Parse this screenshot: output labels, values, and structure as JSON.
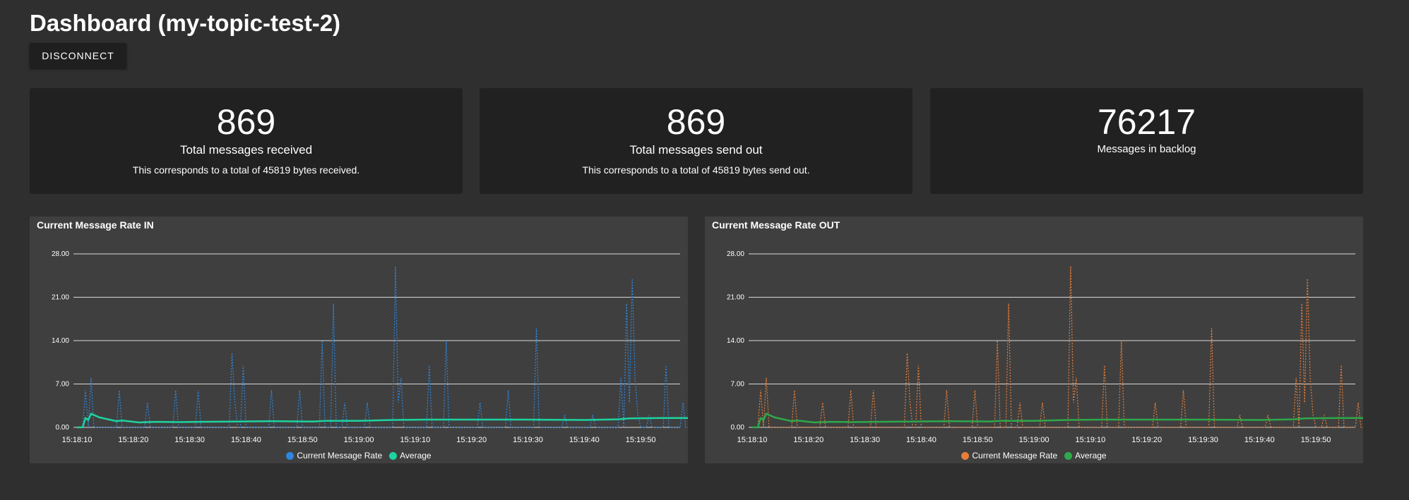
{
  "page": {
    "title": "Dashboard (my-topic-test-2)"
  },
  "toolbar": {
    "disconnect_label": "DISCONNECT"
  },
  "cards": {
    "received": {
      "value": "869",
      "label": "Total messages received",
      "desc": "This corresponds to a total of 45819 bytes received."
    },
    "sent": {
      "value": "869",
      "label": "Total messages send out",
      "desc": "This corresponds to a total of 45819 bytes send out."
    },
    "backlog": {
      "value": "76217",
      "label": "Messages in backlog"
    }
  },
  "charts": {
    "in": {
      "title": "Current Message Rate IN",
      "legend_rate": "Current Message Rate",
      "legend_avg": "Average",
      "rate_color": "#2e86de",
      "avg_color": "#1dd3a0"
    },
    "out": {
      "title": "Current Message Rate OUT",
      "legend_rate": "Current Message Rate",
      "legend_avg": "Average",
      "rate_color": "#e67e3a",
      "avg_color": "#2ea84a"
    }
  },
  "chart_data": [
    {
      "type": "line",
      "title": "Current Message Rate IN",
      "xlabel": "",
      "ylabel": "",
      "x_start": "15:18:10",
      "x_end": "15:19:57",
      "x_ticks": [
        "15:18:10",
        "15:18:20",
        "15:18:30",
        "15:18:40",
        "15:18:50",
        "15:19:00",
        "15:19:10",
        "15:19:20",
        "15:19:30",
        "15:19:40",
        "15:19:50"
      ],
      "y_ticks": [
        "0.00",
        "7.00",
        "14.00",
        "21.00",
        "28.00"
      ],
      "ylim": [
        0,
        28
      ],
      "grid": true,
      "legend": "bottom-center",
      "series": [
        {
          "name": "Current Message Rate",
          "style": "dotted",
          "points": [
            [
              0,
              0
            ],
            [
              1,
              0
            ],
            [
              1.5,
              6
            ],
            [
              2,
              0
            ],
            [
              2.5,
              8
            ],
            [
              3,
              0
            ],
            [
              7,
              0
            ],
            [
              7.5,
              6
            ],
            [
              8,
              0
            ],
            [
              12,
              0
            ],
            [
              12.5,
              4
            ],
            [
              13,
              0
            ],
            [
              17,
              0
            ],
            [
              17.5,
              6
            ],
            [
              18,
              0
            ],
            [
              21,
              0
            ],
            [
              21.5,
              6
            ],
            [
              22,
              0
            ],
            [
              27,
              0
            ],
            [
              27.5,
              12
            ],
            [
              28,
              4
            ],
            [
              28.5,
              0
            ],
            [
              29,
              0
            ],
            [
              29.5,
              10
            ],
            [
              30,
              0
            ],
            [
              34,
              0
            ],
            [
              34.5,
              6
            ],
            [
              35,
              0
            ],
            [
              39,
              0
            ],
            [
              39.5,
              6
            ],
            [
              40,
              0
            ],
            [
              43,
              0
            ],
            [
              43.5,
              14
            ],
            [
              44,
              0
            ],
            [
              45,
              0
            ],
            [
              45.5,
              20
            ],
            [
              46,
              0
            ],
            [
              47,
              0
            ],
            [
              47.5,
              4
            ],
            [
              48,
              0
            ],
            [
              51,
              0
            ],
            [
              51.5,
              4
            ],
            [
              52,
              0
            ],
            [
              56,
              0
            ],
            [
              56.5,
              26
            ],
            [
              57,
              4
            ],
            [
              57.5,
              8
            ],
            [
              58,
              0
            ],
            [
              62,
              0
            ],
            [
              62.5,
              10
            ],
            [
              63,
              0
            ],
            [
              65,
              0
            ],
            [
              65.5,
              14
            ],
            [
              66,
              0
            ],
            [
              71,
              0
            ],
            [
              71.5,
              4
            ],
            [
              72,
              0
            ],
            [
              76,
              0
            ],
            [
              76.5,
              6
            ],
            [
              77,
              0
            ],
            [
              81,
              0
            ],
            [
              81.5,
              16
            ],
            [
              82,
              0
            ],
            [
              86,
              0
            ],
            [
              86.5,
              2
            ],
            [
              87,
              0
            ],
            [
              91,
              0
            ],
            [
              91.5,
              2
            ],
            [
              92,
              0
            ],
            [
              96,
              0
            ],
            [
              96.5,
              8
            ],
            [
              97,
              0
            ],
            [
              97.5,
              20
            ],
            [
              98,
              4
            ],
            [
              98.5,
              24
            ],
            [
              99,
              8
            ],
            [
              99.5,
              2
            ],
            [
              100,
              0
            ],
            [
              101,
              0
            ],
            [
              101.5,
              2
            ],
            [
              102,
              0
            ],
            [
              104,
              0
            ],
            [
              104.5,
              10
            ],
            [
              105,
              0
            ],
            [
              107,
              0
            ],
            [
              107.5,
              4
            ],
            [
              108,
              0
            ],
            [
              110,
              0
            ]
          ]
        },
        {
          "name": "Average",
          "style": "solid",
          "points": [
            [
              0,
              0
            ],
            [
              1,
              0
            ],
            [
              1.5,
              1.5
            ],
            [
              2,
              1.2
            ],
            [
              2.5,
              2.2
            ],
            [
              4,
              1.6
            ],
            [
              7,
              1.0
            ],
            [
              8,
              1.1
            ],
            [
              11,
              0.8
            ],
            [
              14,
              0.9
            ],
            [
              18,
              0.85
            ],
            [
              22,
              0.9
            ],
            [
              28,
              0.95
            ],
            [
              35,
              1.0
            ],
            [
              42,
              0.95
            ],
            [
              44,
              1.05
            ],
            [
              50,
              1.05
            ],
            [
              56,
              1.2
            ],
            [
              62,
              1.25
            ],
            [
              70,
              1.25
            ],
            [
              80,
              1.25
            ],
            [
              90,
              1.2
            ],
            [
              96,
              1.3
            ],
            [
              98,
              1.45
            ],
            [
              104,
              1.5
            ],
            [
              110,
              1.5
            ]
          ]
        }
      ]
    },
    {
      "type": "line",
      "title": "Current Message Rate OUT",
      "xlabel": "",
      "ylabel": "",
      "x_start": "15:18:10",
      "x_end": "15:19:57",
      "x_ticks": [
        "15:18:10",
        "15:18:20",
        "15:18:30",
        "15:18:40",
        "15:18:50",
        "15:19:00",
        "15:19:10",
        "15:19:20",
        "15:19:30",
        "15:19:40",
        "15:19:50"
      ],
      "y_ticks": [
        "0.00",
        "7.00",
        "14.00",
        "21.00",
        "28.00"
      ],
      "ylim": [
        0,
        28
      ],
      "grid": true,
      "legend": "bottom-center",
      "series": [
        {
          "name": "Current Message Rate",
          "style": "dotted",
          "points": [
            [
              0,
              0
            ],
            [
              1,
              0
            ],
            [
              1.5,
              6
            ],
            [
              2,
              0
            ],
            [
              2.5,
              8
            ],
            [
              3,
              0
            ],
            [
              7,
              0
            ],
            [
              7.5,
              6
            ],
            [
              8,
              0
            ],
            [
              12,
              0
            ],
            [
              12.5,
              4
            ],
            [
              13,
              0
            ],
            [
              17,
              0
            ],
            [
              17.5,
              6
            ],
            [
              18,
              0
            ],
            [
              21,
              0
            ],
            [
              21.5,
              6
            ],
            [
              22,
              0
            ],
            [
              27,
              0
            ],
            [
              27.5,
              12
            ],
            [
              28,
              4
            ],
            [
              28.5,
              0
            ],
            [
              29,
              0
            ],
            [
              29.5,
              10
            ],
            [
              30,
              0
            ],
            [
              34,
              0
            ],
            [
              34.5,
              6
            ],
            [
              35,
              0
            ],
            [
              39,
              0
            ],
            [
              39.5,
              6
            ],
            [
              40,
              0
            ],
            [
              43,
              0
            ],
            [
              43.5,
              14
            ],
            [
              44,
              0
            ],
            [
              45,
              0
            ],
            [
              45.5,
              20
            ],
            [
              46,
              0
            ],
            [
              47,
              0
            ],
            [
              47.5,
              4
            ],
            [
              48,
              0
            ],
            [
              51,
              0
            ],
            [
              51.5,
              4
            ],
            [
              52,
              0
            ],
            [
              56,
              0
            ],
            [
              56.5,
              26
            ],
            [
              57,
              4
            ],
            [
              57.5,
              8
            ],
            [
              58,
              0
            ],
            [
              62,
              0
            ],
            [
              62.5,
              10
            ],
            [
              63,
              0
            ],
            [
              65,
              0
            ],
            [
              65.5,
              14
            ],
            [
              66,
              0
            ],
            [
              71,
              0
            ],
            [
              71.5,
              4
            ],
            [
              72,
              0
            ],
            [
              76,
              0
            ],
            [
              76.5,
              6
            ],
            [
              77,
              0
            ],
            [
              81,
              0
            ],
            [
              81.5,
              16
            ],
            [
              82,
              0
            ],
            [
              86,
              0
            ],
            [
              86.5,
              2
            ],
            [
              87,
              0
            ],
            [
              91,
              0
            ],
            [
              91.5,
              2
            ],
            [
              92,
              0
            ],
            [
              96,
              0
            ],
            [
              96.5,
              8
            ],
            [
              97,
              0
            ],
            [
              97.5,
              20
            ],
            [
              98,
              4
            ],
            [
              98.5,
              24
            ],
            [
              99,
              8
            ],
            [
              99.5,
              2
            ],
            [
              100,
              0
            ],
            [
              101,
              0
            ],
            [
              101.5,
              2
            ],
            [
              102,
              0
            ],
            [
              104,
              0
            ],
            [
              104.5,
              10
            ],
            [
              105,
              0
            ],
            [
              107,
              0
            ],
            [
              107.5,
              4
            ],
            [
              108,
              0
            ],
            [
              110,
              0
            ]
          ]
        },
        {
          "name": "Average",
          "style": "solid",
          "points": [
            [
              0,
              0
            ],
            [
              1,
              0
            ],
            [
              1.5,
              1.5
            ],
            [
              2,
              1.2
            ],
            [
              2.5,
              2.2
            ],
            [
              4,
              1.6
            ],
            [
              7,
              1.0
            ],
            [
              8,
              1.1
            ],
            [
              11,
              0.8
            ],
            [
              14,
              0.9
            ],
            [
              18,
              0.85
            ],
            [
              22,
              0.9
            ],
            [
              28,
              0.95
            ],
            [
              35,
              1.0
            ],
            [
              42,
              0.95
            ],
            [
              44,
              1.05
            ],
            [
              50,
              1.05
            ],
            [
              56,
              1.2
            ],
            [
              62,
              1.25
            ],
            [
              70,
              1.25
            ],
            [
              80,
              1.25
            ],
            [
              90,
              1.2
            ],
            [
              96,
              1.3
            ],
            [
              98,
              1.45
            ],
            [
              104,
              1.5
            ],
            [
              110,
              1.5
            ]
          ]
        }
      ]
    }
  ]
}
